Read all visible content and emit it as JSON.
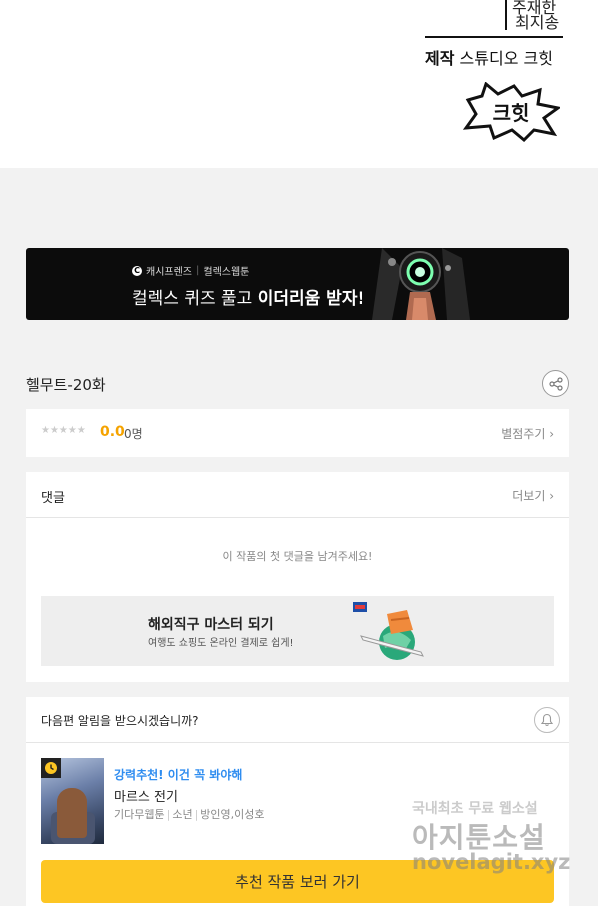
{
  "credits": {
    "name_line1": "주재한",
    "name_line2": "최지송",
    "studio_prefix": "제작",
    "studio_name": "스튜디오 크힛",
    "logo_text": "크힛"
  },
  "banner": {
    "brand_left": "캐시프렌즈",
    "brand_right": "컬렉스웹툰",
    "title_normal": "컬렉스 퀴즈 풀고 ",
    "title_bold": "이더리움 받자!"
  },
  "episode": {
    "title": "헬무트-20화"
  },
  "rating": {
    "stars": "★★★★★",
    "score": "0.0",
    "count": "0명",
    "rate_label": "별점주기 ›"
  },
  "comments": {
    "title": "댓글",
    "more_label": "더보기 ›",
    "empty_message": "이 작품의 첫 댓글을 남겨주세요!",
    "ad_title": "해외직구 마스터 되기",
    "ad_subtitle": "여행도 쇼핑도 온라인 결제로 쉽게!"
  },
  "next": {
    "question": "다음편 알림을 받으시겠습니까?",
    "rec_tag": "강력추천! 이건 꼭 봐야해",
    "rec_title": "마르스 전기",
    "rec_meta": [
      "기다무웹툰",
      "소년",
      "방인영,이성호"
    ],
    "cta_label": "추천 작품 보러 가기"
  },
  "watermark": {
    "line1": "국내최초 무료 웹소설",
    "line2": "아지툰소설",
    "line3": "novelagit.xyz"
  },
  "colors": {
    "accent_yellow": "#fdc623",
    "link_blue": "#2f8df0",
    "score_orange": "#f5a300"
  }
}
